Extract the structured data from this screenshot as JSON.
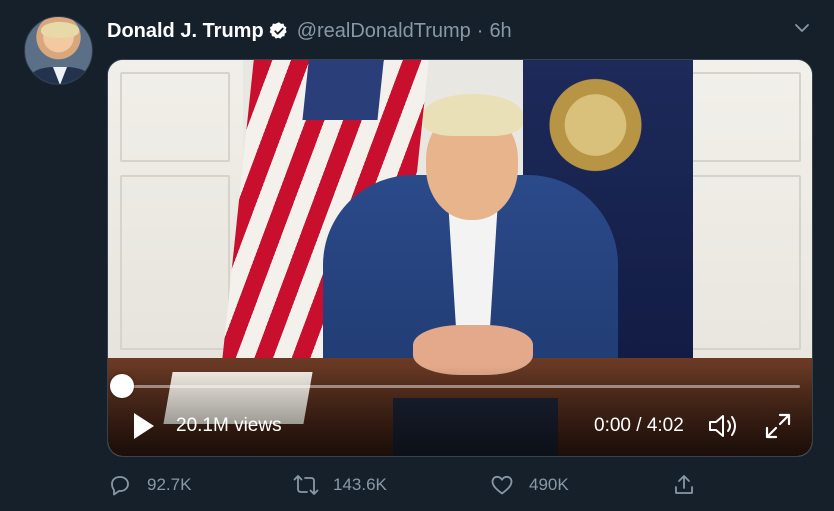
{
  "tweet": {
    "author_name": "Donald J. Trump",
    "handle": "@realDonaldTrump",
    "separator": "·",
    "time": "6h",
    "verified": true,
    "avatar_icon": "profile-photo"
  },
  "video": {
    "views_label": "20.1M views",
    "timecode": "0:00 / 4:02",
    "progress": 0.0,
    "controls": {
      "play_icon": "play-icon",
      "volume_icon": "volume-icon",
      "fullscreen_icon": "fullscreen-icon"
    }
  },
  "actions": {
    "reply_count": "92.7K",
    "retweet_count": "143.6K",
    "like_count": "490K"
  },
  "colors": {
    "background": "#15202b",
    "secondary_text": "#8899a6",
    "verified_badge": "#ffffff"
  }
}
